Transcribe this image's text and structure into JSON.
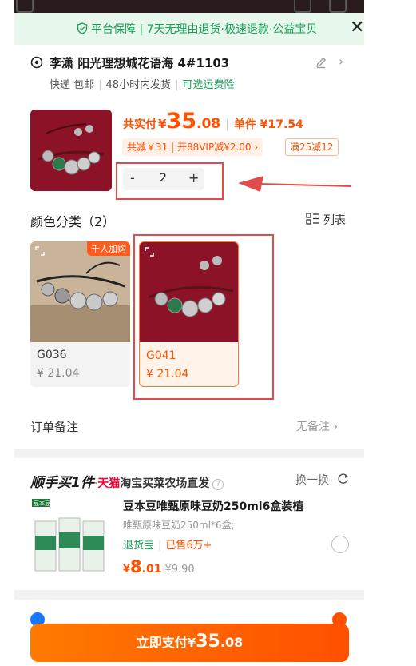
{
  "colors": {
    "accent": "#ff5000",
    "guarantee_green": "#18a058",
    "highlight_red": "#e04b4b",
    "product_bg": "#8c1228"
  },
  "banner": {
    "text": "平台保障 | 7天无理由退货·极速退款·公益宝贝",
    "shield_icon": "shield-check-icon",
    "close_icon": "close-icon"
  },
  "address": {
    "text": "李潇 阳光理想城花语海 4#1103",
    "shipping": "快递 包邮",
    "dispatch": "48小时内发货",
    "insurance": "可选运费险"
  },
  "product": {
    "total_label": "共实付",
    "total_currency": "¥",
    "total_int": "35",
    "total_dec": ".08",
    "unit_label": "单件 ¥17.54",
    "discount_text": "共减￥31 | 开88VIP减¥2.00 ›",
    "promo_tag": "满25减12",
    "quantity": "2",
    "minus": "-",
    "plus": "+"
  },
  "colors_section": {
    "title": "颜色分类（2）",
    "view_label": "列表",
    "variants": [
      {
        "name": "G036",
        "price": "¥ 21.04",
        "badge": "千人加购",
        "selected": false
      },
      {
        "name": "G041",
        "price": "¥ 21.04",
        "badge": "",
        "selected": true
      }
    ]
  },
  "order_note": {
    "label": "订单备注",
    "value": "无备注 ›"
  },
  "recommend": {
    "title_main": "顺手买1件",
    "title_dot": "·",
    "title_tmall": "天猫",
    "title_rest": "淘宝买菜农场直发",
    "help": "?",
    "refresh_label": "换一换",
    "product_name": "豆本豆唯甄原味豆奶250ml6盒装植",
    "product_spec": "唯甄原味豆奶250ml*6盒;",
    "tag_return": "退货宝",
    "tag_sold": "已售6万+",
    "price_currency": "¥",
    "price_int": "8",
    "price_dec": ".01",
    "original_price": "¥9.90",
    "brand_label": "豆本豆"
  },
  "pay": {
    "label": "立即支付",
    "currency": "¥",
    "int": "35",
    "dec": ".08"
  }
}
